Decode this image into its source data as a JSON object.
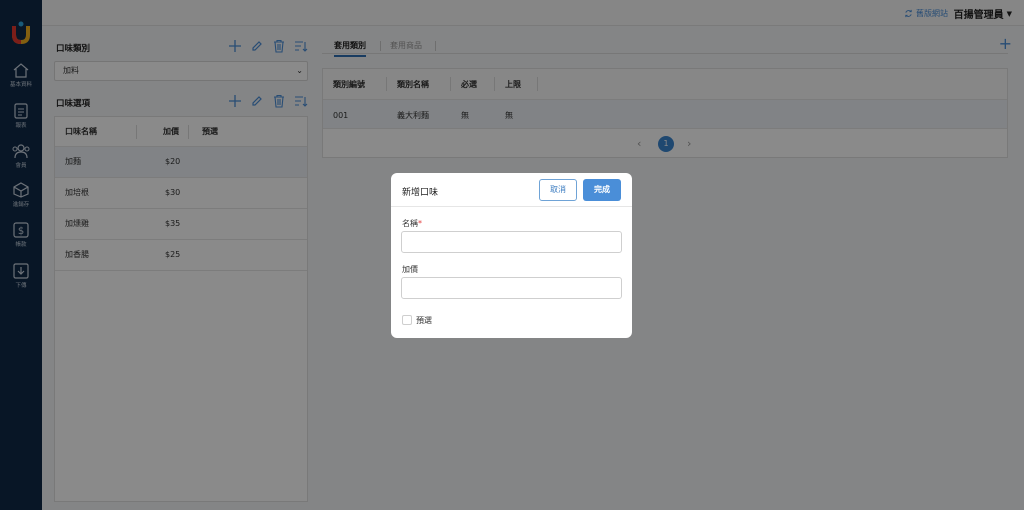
{
  "sidebar": {
    "items": [
      {
        "label": "基本資料",
        "icon": "home-icon"
      },
      {
        "label": "報表",
        "icon": "report-icon"
      },
      {
        "label": "會員",
        "icon": "members-icon"
      },
      {
        "label": "進銷存",
        "icon": "inventory-icon"
      },
      {
        "label": "帳款",
        "icon": "billing-icon"
      },
      {
        "label": "下傳",
        "icon": "download-icon"
      }
    ]
  },
  "topbar": {
    "old_site_label": "舊版網站",
    "admin_label": "百揚管理員"
  },
  "left": {
    "category_title": "口味類別",
    "category_selected": "加料",
    "options_title": "口味選項",
    "table": {
      "headers": [
        "口味名稱",
        "加價",
        "預選"
      ],
      "rows": [
        {
          "name": "加麵",
          "price": "$20"
        },
        {
          "name": "加培根",
          "price": "$30"
        },
        {
          "name": "加燻雞",
          "price": "$35"
        },
        {
          "name": "加香腸",
          "price": "$25"
        }
      ]
    }
  },
  "right": {
    "tabs": [
      {
        "label": "套用類別",
        "active": true
      },
      {
        "label": "套用商品",
        "active": false
      }
    ],
    "table": {
      "headers": [
        "類別編號",
        "類別名稱",
        "必選",
        "上限"
      ],
      "rows": [
        {
          "id": "001",
          "name": "義大利麵",
          "required": "無",
          "limit": "無"
        }
      ]
    },
    "pager": {
      "current": "1"
    }
  },
  "modal": {
    "title": "新增口味",
    "cancel_label": "取消",
    "done_label": "完成",
    "name_label": "名稱",
    "name_required_mark": "*",
    "name_value": "",
    "price_label": "加價",
    "price_value": "",
    "preselect_label": "預選"
  },
  "colors": {
    "sidebar": "#0f2a47",
    "accent": "#4a8ed8",
    "overlay": "rgba(0,0,0,0.46)"
  }
}
